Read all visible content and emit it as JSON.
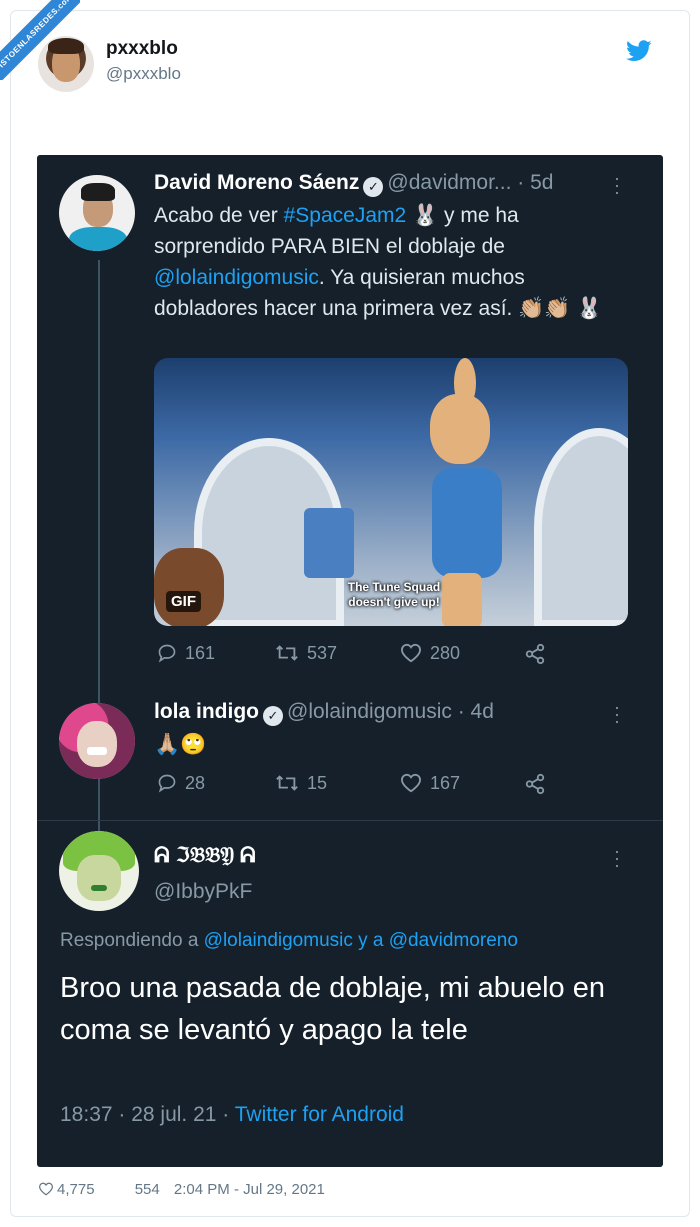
{
  "watermark": "VISTOENLASREDES.com",
  "outer_tweet": {
    "name": "pxxxblo",
    "handle": "@pxxxblo",
    "likes": "4,775",
    "retweets": "554",
    "timestamp": "2:04 PM - Jul 29, 2021"
  },
  "screenshot": {
    "tweet1": {
      "name": "David Moreno Sáenz",
      "handle": "@davidmor...",
      "age": "· 5d",
      "text_before": "Acabo de ver ",
      "hashtag": "#SpaceJam2",
      "text_after_hashtag": " 🐰 y me ha sorprendido PARA BIEN el doblaje de ",
      "mention": "@lolaindigomusic",
      "text_end": ". Ya quisieran muchos dobladores hacer una primera vez así. 👏🏼👏🏼 🐰",
      "media": {
        "badge": "GIF",
        "caption": "The Tune Squad doesn't give up!"
      },
      "replies": "161",
      "retweets": "537",
      "likes": "280"
    },
    "tweet2": {
      "name": "lola indigo",
      "handle": "@lolaindigomusic · 4d",
      "text": "🙏🏼🙄",
      "replies": "28",
      "retweets": "15",
      "likes": "167"
    },
    "tweet3": {
      "name": "ᕱ ℑ𝔅𝔅𝔜 ᕱ",
      "handle": "@IbbyPkF",
      "replying_prefix": "Respondiendo a ",
      "replying_mentions": "@lolaindigomusic y a @davidmoreno",
      "text": "Broo una pasada de doblaje, mi abuelo en coma se levantó y apago la tele",
      "time": "18:37 · 28 jul. 21 · ",
      "source": "Twitter for Android"
    }
  },
  "colors": {
    "dark_bg": "#15202b",
    "accent": "#1da1f2",
    "muted": "#8899a6"
  },
  "icons": [
    "twitter-bird-icon",
    "verified-icon",
    "more-dots-icon",
    "reply-icon",
    "retweet-icon",
    "like-icon",
    "share-icon"
  ]
}
